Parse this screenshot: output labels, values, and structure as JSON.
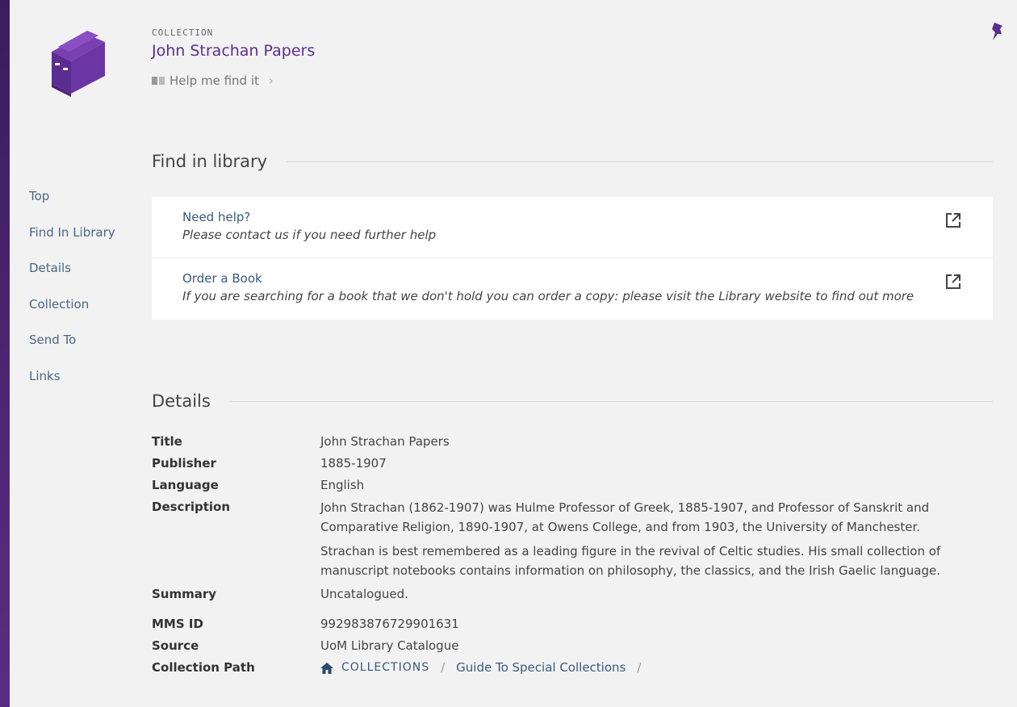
{
  "header": {
    "type_label": "COLLECTION",
    "title": "John Strachan Papers",
    "help_link": "Help me find it",
    "icons": {
      "thumbnail": "books-icon",
      "help": "map-book-icon",
      "chevron": "chevron-right-icon",
      "pin": "pin-icon"
    }
  },
  "colors": {
    "accent": "#5c2d91",
    "link": "#3a5a7c",
    "panel": "#f2f2f2",
    "frame": "#4a2470"
  },
  "sidenav": {
    "items": [
      "Top",
      "Find In Library",
      "Details",
      "Collection",
      "Send To",
      "Links"
    ]
  },
  "find_in_library": {
    "heading": "Find in library",
    "services": [
      {
        "title": "Need help?",
        "description": "Please contact us if you need further help"
      },
      {
        "title": "Order a Book",
        "description": "If you are searching for a book that we don't hold you can order a copy: please visit the Library website to find out more"
      }
    ]
  },
  "details": {
    "heading": "Details",
    "rows": {
      "title": {
        "label": "Title",
        "value": "John Strachan Papers"
      },
      "publisher": {
        "label": "Publisher",
        "value": "1885-1907"
      },
      "language": {
        "label": "Language",
        "value": "English"
      },
      "description": {
        "label": "Description",
        "p1": "John Strachan (1862-1907) was Hulme Professor of Greek, 1885-1907, and Professor of Sanskrit and Comparative Religion, 1890-1907, at Owens College, and from 1903, the University of Manchester.",
        "p2": "Strachan is best remembered as a leading figure in the revival of Celtic studies. His small collection of manuscript notebooks contains information on philosophy, the classics, and the Irish Gaelic language."
      },
      "summary": {
        "label": "Summary",
        "value": "Uncatalogued."
      },
      "mms_id": {
        "label": "MMS ID",
        "value": "992983876729901631"
      },
      "source": {
        "label": "Source",
        "value": "UoM Library Catalogue"
      },
      "collection_path": {
        "label": "Collection Path",
        "root": "COLLECTIONS",
        "item": "Guide To Special Collections"
      }
    }
  }
}
